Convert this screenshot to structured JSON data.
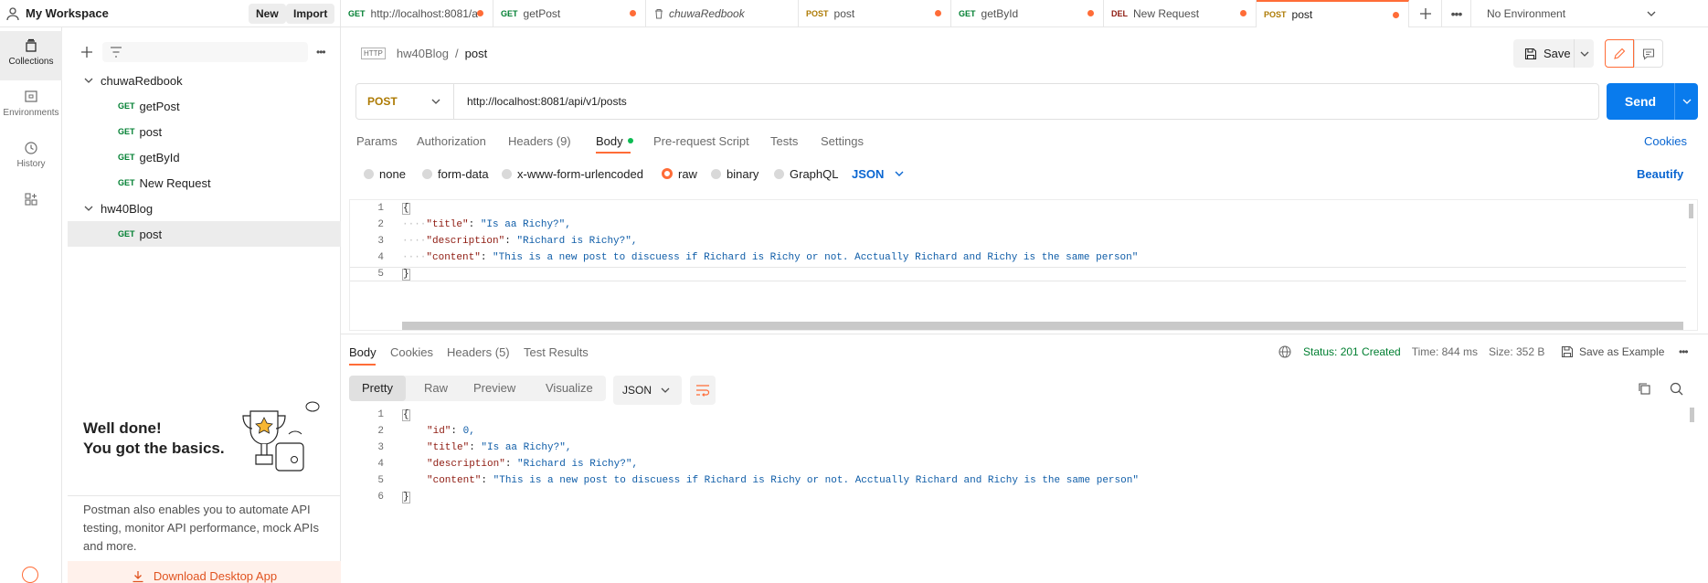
{
  "workspace": {
    "name": "My Workspace",
    "new_label": "New",
    "import_label": "Import"
  },
  "tabs": [
    {
      "method": "GET",
      "label": "http://localhost:8081/a",
      "dirty": true
    },
    {
      "method": "GET",
      "label": "getPost",
      "dirty": true
    },
    {
      "method": "",
      "label": "chuwaRedbook",
      "dirty": false
    },
    {
      "method": "POST",
      "label": "post",
      "dirty": true
    },
    {
      "method": "GET",
      "label": "getById",
      "dirty": true
    },
    {
      "method": "DEL",
      "label": "New Request",
      "dirty": true
    },
    {
      "method": "POST",
      "label": "post",
      "dirty": true,
      "active": true
    }
  ],
  "environment": "No Environment",
  "rail": [
    {
      "label": "Collections",
      "icon": "collections-icon"
    },
    {
      "label": "Environments",
      "icon": "environments-icon"
    },
    {
      "label": "History",
      "icon": "history-icon"
    },
    {
      "label": "",
      "icon": "apps-icon"
    }
  ],
  "sidebar": {
    "collections": [
      {
        "name": "chuwaRedbook",
        "items": [
          {
            "method": "GET",
            "name": "getPost"
          },
          {
            "method": "GET",
            "name": "post"
          },
          {
            "method": "GET",
            "name": "getById"
          },
          {
            "method": "GET",
            "name": "New Request"
          }
        ]
      },
      {
        "name": "hw40Blog",
        "items": [
          {
            "method": "GET",
            "name": "post"
          }
        ]
      }
    ],
    "promo": {
      "title_line1": "Well done!",
      "title_line2": "You got the basics.",
      "body": "Postman also enables you to automate API testing, monitor API performance, mock APIs and more.",
      "download_label": "Download Desktop App"
    }
  },
  "request": {
    "breadcrumb_parent": "hw40Blog",
    "breadcrumb_sep": "/",
    "breadcrumb_current": "post",
    "save_label": "Save",
    "method": "POST",
    "url": "http://localhost:8081/api/v1/posts",
    "send_label": "Send",
    "tabs": [
      "Params",
      "Authorization",
      "Headers (9)",
      "Body",
      "Pre-request Script",
      "Tests",
      "Settings"
    ],
    "cookies_label": "Cookies",
    "body_options": [
      "none",
      "form-data",
      "x-www-form-urlencoded",
      "raw",
      "binary",
      "GraphQL"
    ],
    "body_format": "JSON",
    "beautify_label": "Beautify",
    "body_lines": [
      {
        "n": "1",
        "text": "{"
      },
      {
        "n": "2",
        "key": "\"title\"",
        "val": "\"Is aa Richy?\","
      },
      {
        "n": "3",
        "key": "\"description\"",
        "val": "\"Richard is Richy?\","
      },
      {
        "n": "4",
        "key": "\"content\"",
        "val": "\"This is a new post to discuess if Richard is Richy or not. Acctually Richard and Richy is the same person\""
      },
      {
        "n": "5",
        "text": "}"
      }
    ]
  },
  "response": {
    "tabs": [
      "Body",
      "Cookies",
      "Headers (5)",
      "Test Results"
    ],
    "status": "Status: 201 Created",
    "time": "Time: 844 ms",
    "size": "Size: 352 B",
    "save_example_label": "Save as Example",
    "formats": [
      "Pretty",
      "Raw",
      "Preview",
      "Visualize"
    ],
    "format_type": "JSON",
    "body_lines": [
      {
        "n": "1",
        "text": "{"
      },
      {
        "n": "2",
        "key": "\"id\"",
        "val": "0,"
      },
      {
        "n": "3",
        "key": "\"title\"",
        "val": "\"Is aa Richy?\","
      },
      {
        "n": "4",
        "key": "\"description\"",
        "val": "\"Richard is Richy?\","
      },
      {
        "n": "5",
        "key": "\"content\"",
        "val": "\"This is a new post to discuess if Richard is Richy or not. Acctually Richard and Richy is the same person\""
      },
      {
        "n": "6",
        "text": "}"
      }
    ]
  },
  "colors": {
    "accent": "#ff6c37",
    "send": "#097bed",
    "get": "#007f31",
    "post": "#ad7a03",
    "del": "#8e1a10"
  }
}
